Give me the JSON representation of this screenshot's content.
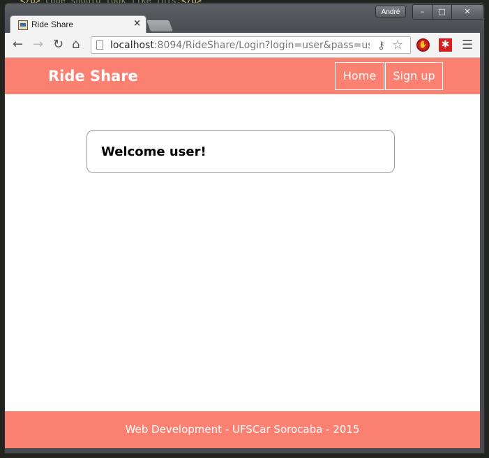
{
  "window": {
    "user_badge": "André",
    "minimize": "–",
    "maximize": "□",
    "close": "✕"
  },
  "tab": {
    "title": "Ride Share",
    "close": "×"
  },
  "toolbar": {
    "url_host": "localhost",
    "url_rest": ":8094/RideShare/Login?login=user&pass=us"
  },
  "navbar": {
    "brand": "Ride Share",
    "links": [
      "Home",
      "Sign up"
    ]
  },
  "main": {
    "welcome": "Welcome user!"
  },
  "footer": {
    "text": "Web Development - UFSCar Sorocaba - 2015"
  },
  "colors": {
    "brand_salmon": "#fa8072"
  }
}
